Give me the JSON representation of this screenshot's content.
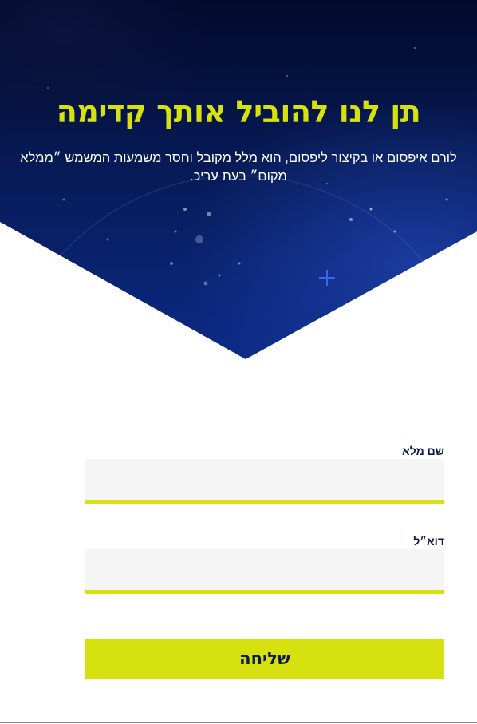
{
  "hero": {
    "title": "תן לנו להוביל אותך קדימה",
    "text": "לורם איפסום או בקיצור ליפסום, הוא מלל מקובל וחסר משמעות המשמש ״ממלא מקום״ בעת עריכ."
  },
  "form": {
    "fields": [
      {
        "label": "שם מלא",
        "value": ""
      },
      {
        "label": "דוא״ל",
        "value": ""
      }
    ],
    "submit_label": "שליחה"
  },
  "colors": {
    "accent": "#d6e10f",
    "hero_dark": "#020a2c",
    "hero_blue": "#0c2a86",
    "label_text": "#0d1b4b",
    "input_bg": "#f5f5f5"
  }
}
